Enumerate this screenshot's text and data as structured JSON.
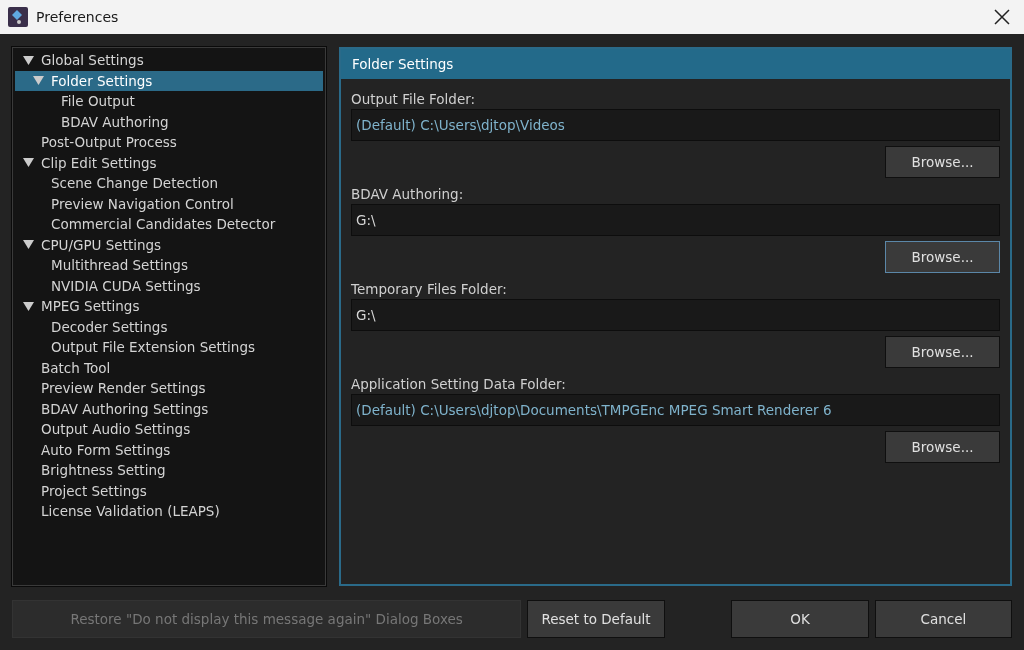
{
  "window": {
    "title": "Preferences"
  },
  "tree": [
    {
      "label": "Global Settings",
      "expanded": true,
      "selected": false,
      "children": [
        {
          "label": "Folder Settings",
          "expanded": true,
          "selected": true,
          "children": [
            {
              "label": "File Output",
              "selected": false
            },
            {
              "label": "BDAV Authoring",
              "selected": false
            }
          ]
        }
      ]
    },
    {
      "label": "Post-Output Process",
      "selected": false
    },
    {
      "label": "Clip Edit Settings",
      "expanded": true,
      "selected": false,
      "children": [
        {
          "label": "Scene Change Detection",
          "selected": false
        },
        {
          "label": "Preview Navigation Control",
          "selected": false
        },
        {
          "label": "Commercial Candidates Detector",
          "selected": false
        }
      ]
    },
    {
      "label": "CPU/GPU Settings",
      "expanded": true,
      "selected": false,
      "children": [
        {
          "label": "Multithread Settings",
          "selected": false
        },
        {
          "label": "NVIDIA CUDA Settings",
          "selected": false
        }
      ]
    },
    {
      "label": "MPEG Settings",
      "expanded": true,
      "selected": false,
      "children": [
        {
          "label": "Decoder Settings",
          "selected": false
        },
        {
          "label": "Output File Extension Settings",
          "selected": false
        }
      ]
    },
    {
      "label": "Batch Tool",
      "selected": false
    },
    {
      "label": "Preview Render Settings",
      "selected": false
    },
    {
      "label": "BDAV Authoring Settings",
      "selected": false
    },
    {
      "label": "Output Audio Settings",
      "selected": false
    },
    {
      "label": "Auto Form Settings",
      "selected": false
    },
    {
      "label": "Brightness Setting",
      "selected": false
    },
    {
      "label": "Project Settings",
      "selected": false
    },
    {
      "label": "License Validation (LEAPS)",
      "selected": false
    }
  ],
  "panel": {
    "title": "Folder Settings",
    "folders": [
      {
        "label": "Output File Folder:",
        "value": "(Default) C:\\Users\\djtop\\Videos",
        "is_default": true,
        "button": "Browse...",
        "focused": false
      },
      {
        "label": "BDAV Authoring:",
        "value": "G:\\",
        "is_default": false,
        "button": "Browse...",
        "focused": true
      },
      {
        "label": "Temporary Files Folder:",
        "value": "G:\\",
        "is_default": false,
        "button": "Browse...",
        "focused": false
      },
      {
        "label": "Application Setting Data Folder:",
        "value": "(Default) C:\\Users\\djtop\\Documents\\TMPGEnc MPEG Smart Renderer 6",
        "is_default": true,
        "button": "Browse...",
        "focused": false
      }
    ]
  },
  "buttons": {
    "restore": {
      "label": "Restore \"Do not display this message again\" Dialog Boxes",
      "disabled": true
    },
    "reset": "Reset to Default",
    "ok": "OK",
    "cancel": "Cancel"
  }
}
